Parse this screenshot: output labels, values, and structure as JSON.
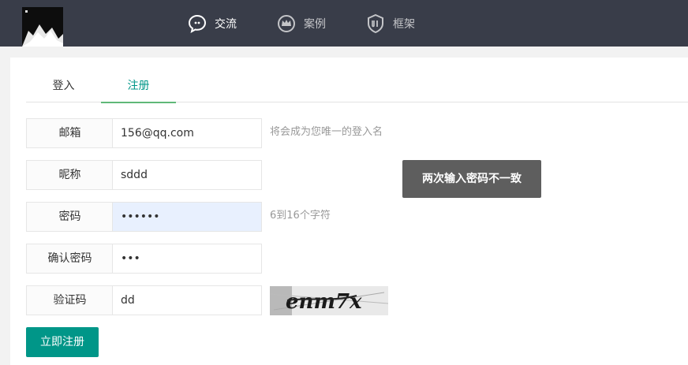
{
  "header": {
    "nav": [
      {
        "label": "交流",
        "icon": "chat-bubble-icon"
      },
      {
        "label": "案例",
        "icon": "crown-icon"
      },
      {
        "label": "框架",
        "icon": "ui-shield-icon"
      }
    ]
  },
  "tabs": {
    "login": "登入",
    "register": "注册",
    "active": "register"
  },
  "form": {
    "email": {
      "label": "邮箱",
      "value": "156@qq.com",
      "hint": "将会成为您唯一的登入名"
    },
    "nickname": {
      "label": "昵称",
      "value": "sddd"
    },
    "password": {
      "label": "密码",
      "value": "••••••",
      "hint": "6到16个字符"
    },
    "confirm": {
      "label": "确认密码",
      "value": "•••"
    },
    "captcha": {
      "label": "验证码",
      "value": "dd",
      "image_text": "enm7x"
    },
    "submit_label": "立即注册"
  },
  "toast": {
    "message": "两次输入密码不一致"
  },
  "colors": {
    "topbar": "#393d49",
    "accent": "#009688",
    "tab_underline": "#5fb878",
    "toast_bg": "#505050"
  }
}
